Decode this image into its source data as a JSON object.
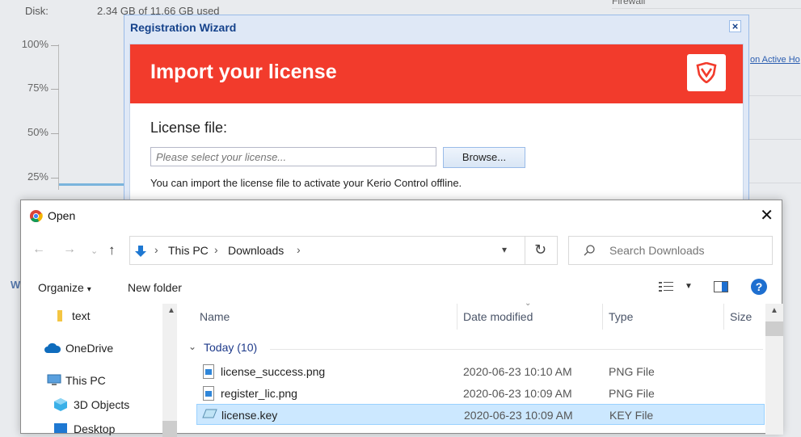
{
  "background": {
    "disk_label": "Disk:",
    "disk_value": "2.34 GB of 11.66 GB used",
    "y_ticks": [
      "100%",
      "75%",
      "50%",
      "25%"
    ],
    "top_right_text": "Firewall",
    "link_text": "on Active Ho",
    "section_letter": "W"
  },
  "wizard": {
    "title": "Registration Wizard",
    "close": "×",
    "heading": "Import your license",
    "accent_color": "#f23b2c",
    "license_label": "License file:",
    "license_placeholder": "Please select your license...",
    "browse_label": "Browse...",
    "hint": "You can import the license file to activate your Kerio Control offline."
  },
  "dialog": {
    "title": "Open",
    "close": "✕",
    "breadcrumb": [
      "This PC",
      "Downloads"
    ],
    "search_placeholder": "Search Downloads",
    "organize_label": "Organize",
    "new_folder_label": "New folder",
    "help": "?",
    "nav_items": [
      {
        "label": "text",
        "icon": "folder-icon"
      },
      {
        "label": "OneDrive",
        "icon": "cloud-icon"
      },
      {
        "label": "This PC",
        "icon": "computer-icon"
      },
      {
        "label": "3D Objects",
        "icon": "cube-icon"
      },
      {
        "label": "Desktop",
        "icon": "desktop-icon"
      }
    ],
    "columns": {
      "name": "Name",
      "date": "Date modified",
      "type": "Type",
      "size": "Size"
    },
    "group": "Today (10)",
    "files": [
      {
        "name": "license_success.png",
        "date": "2020-06-23 10:10 AM",
        "type": "PNG File",
        "selected": false
      },
      {
        "name": "register_lic.png",
        "date": "2020-06-23 10:09 AM",
        "type": "PNG File",
        "selected": false
      },
      {
        "name": "license.key",
        "date": "2020-06-23 10:09 AM",
        "type": "KEY File",
        "selected": true
      }
    ]
  }
}
